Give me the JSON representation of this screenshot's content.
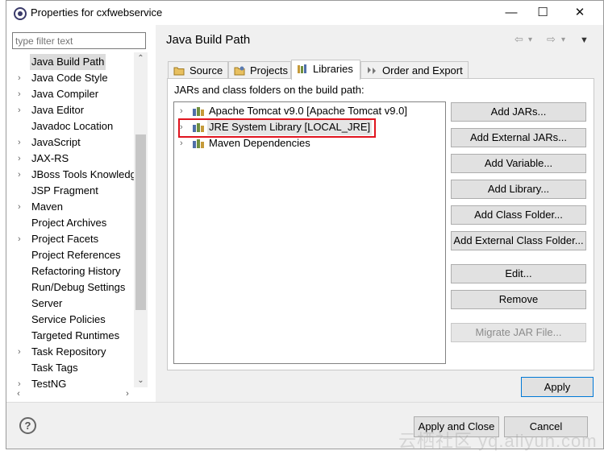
{
  "window": {
    "title": "Properties for cxfwebservice",
    "minimize": "—",
    "maximize": "☐",
    "close": "✕"
  },
  "filter": {
    "placeholder": "type filter text"
  },
  "tree": {
    "items": [
      {
        "label": "Java Build Path",
        "expandable": false,
        "selected": true
      },
      {
        "label": "Java Code Style",
        "expandable": true
      },
      {
        "label": "Java Compiler",
        "expandable": true
      },
      {
        "label": "Java Editor",
        "expandable": true
      },
      {
        "label": "Javadoc Location",
        "expandable": false
      },
      {
        "label": "JavaScript",
        "expandable": true
      },
      {
        "label": "JAX-RS",
        "expandable": true
      },
      {
        "label": "JBoss Tools Knowledge",
        "expandable": true
      },
      {
        "label": "JSP Fragment",
        "expandable": false
      },
      {
        "label": "Maven",
        "expandable": true
      },
      {
        "label": "Project Archives",
        "expandable": false
      },
      {
        "label": "Project Facets",
        "expandable": true
      },
      {
        "label": "Project References",
        "expandable": false
      },
      {
        "label": "Refactoring History",
        "expandable": false
      },
      {
        "label": "Run/Debug Settings",
        "expandable": false
      },
      {
        "label": "Server",
        "expandable": false
      },
      {
        "label": "Service Policies",
        "expandable": false
      },
      {
        "label": "Targeted Runtimes",
        "expandable": false
      },
      {
        "label": "Task Repository",
        "expandable": true
      },
      {
        "label": "Task Tags",
        "expandable": false
      },
      {
        "label": "TestNG",
        "expandable": true
      }
    ]
  },
  "page": {
    "title": "Java Build Path",
    "tabs": [
      {
        "label": "Source"
      },
      {
        "label": "Projects"
      },
      {
        "label": "Libraries",
        "active": true
      },
      {
        "label": "Order and Export"
      }
    ],
    "panel_label": "JARs and class folders on the build path:",
    "libraries": [
      {
        "label": "Apache Tomcat v9.0 [Apache Tomcat v9.0]"
      },
      {
        "label": "JRE System Library [LOCAL_JRE]"
      },
      {
        "label": "Maven Dependencies"
      }
    ],
    "buttons": {
      "add_jars": "Add JARs...",
      "add_external_jars": "Add External JARs...",
      "add_variable": "Add Variable...",
      "add_library": "Add Library...",
      "add_class_folder": "Add Class Folder...",
      "add_external_class_folder": "Add External Class Folder...",
      "edit": "Edit...",
      "remove": "Remove",
      "migrate_jar": "Migrate JAR File..."
    },
    "apply": "Apply"
  },
  "footer": {
    "help": "?",
    "apply_and_close": "Apply and Close",
    "cancel": "Cancel"
  },
  "watermark": "云栖社区 yq.aliyun.com",
  "colors": {
    "highlight": "#e0141e",
    "default_button_border": "#0078d7"
  }
}
